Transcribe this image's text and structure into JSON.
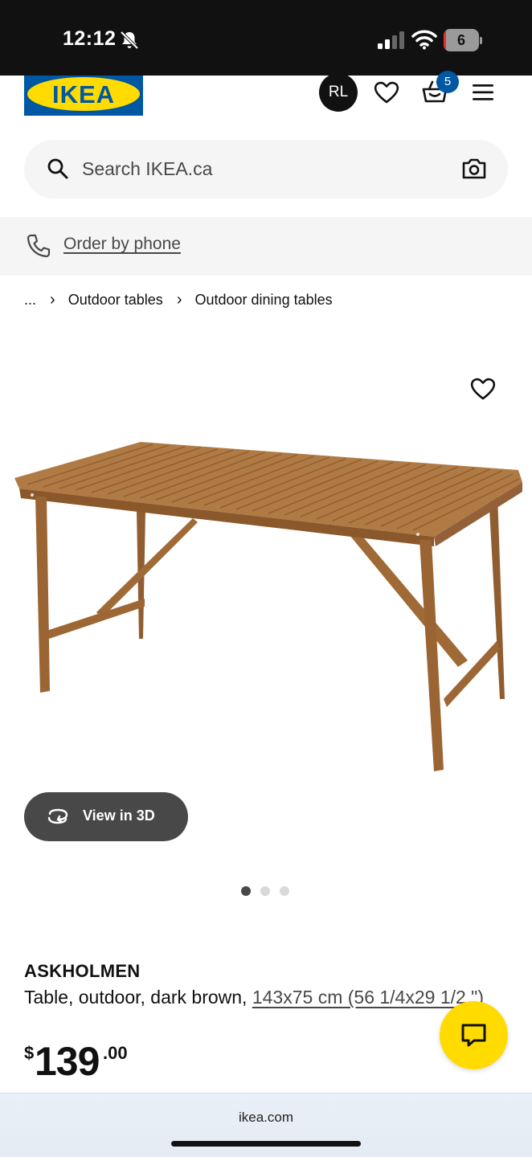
{
  "status_bar": {
    "time": "12:12",
    "battery_level": "6",
    "battery_fraction": 0.06,
    "icons": [
      "bell-off-icon",
      "signal-icon",
      "wifi-icon",
      "battery-icon"
    ]
  },
  "header": {
    "logo_text": "IKEA",
    "avatar_initials": "RL",
    "cart_count": "5",
    "icons": [
      "heart-icon",
      "cart-icon",
      "hamburger-menu-icon"
    ]
  },
  "search": {
    "placeholder": "Search IKEA.ca",
    "icons": [
      "search-icon",
      "camera-icon"
    ]
  },
  "phone_banner": {
    "label": "Order by phone",
    "icon": "phone-icon"
  },
  "breadcrumb": {
    "ellipsis": "...",
    "separator": "›",
    "items": [
      "Outdoor tables",
      "Outdoor dining tables"
    ]
  },
  "gallery": {
    "view_3d_label": "View in 3D",
    "dots_count": 3,
    "active_index": 0,
    "image": "wooden-outdoor-table"
  },
  "product": {
    "name": "ASKHOLMEN",
    "description_prefix": "Table, outdoor, dark brown, ",
    "size_text": "143x75 cm (56 1/4x29 1/2 \")",
    "price": {
      "currency": "$",
      "integer": "139",
      "decimal": ".00"
    }
  },
  "chat": {
    "icon": "chat-icon"
  },
  "browser": {
    "url": "ikea.com"
  },
  "colors": {
    "ikea_blue": "#0058a3",
    "ikea_yellow": "#ffdb00",
    "status_bar": "#111111",
    "surface_gray": "#f5f5f5",
    "button_dark": "#484848",
    "wood": "#a8733f"
  }
}
